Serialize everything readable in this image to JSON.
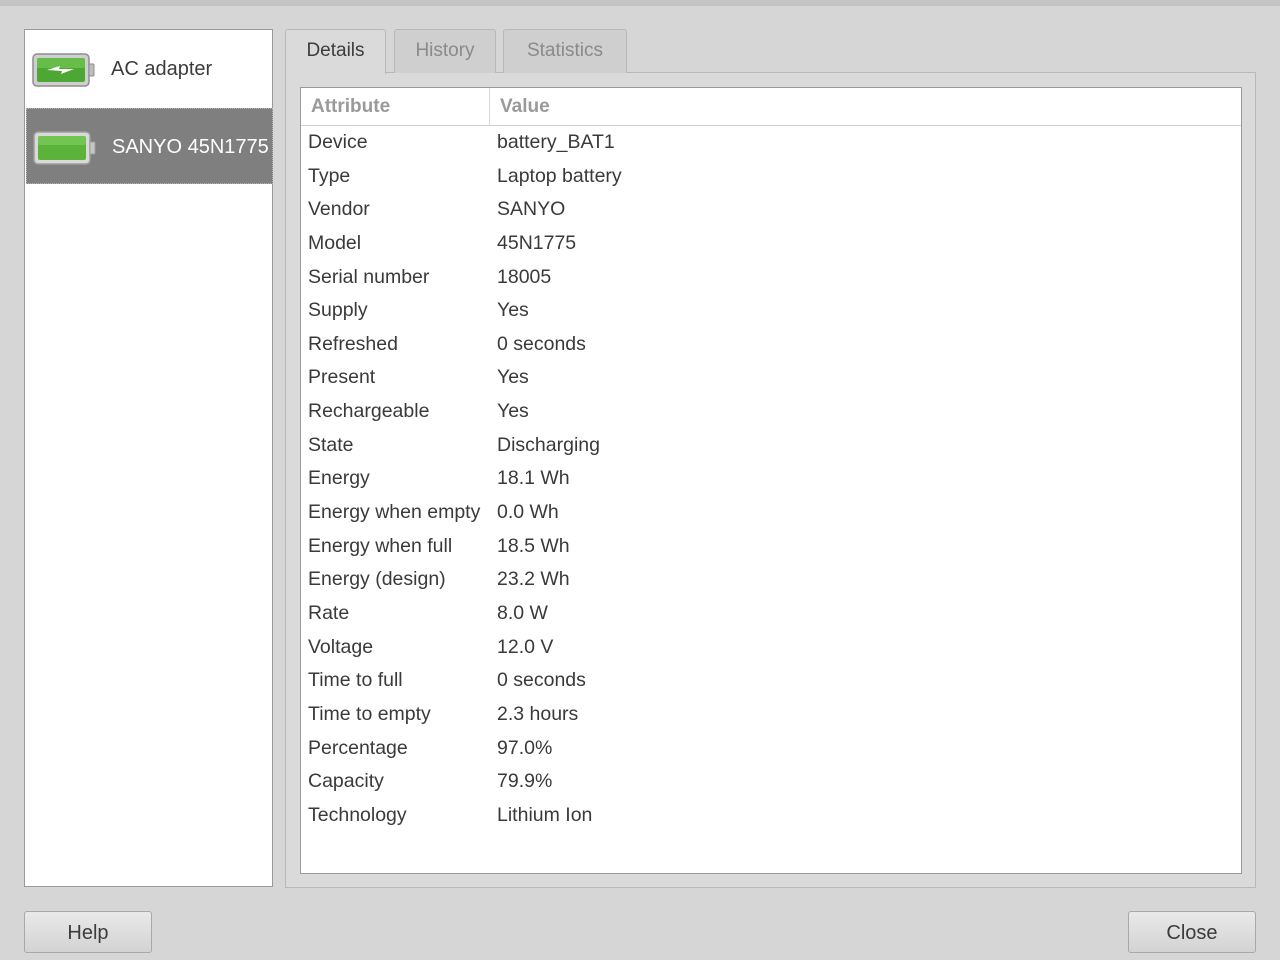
{
  "devices": [
    {
      "label": "AC adapter",
      "icon": "ac-adapter-icon"
    },
    {
      "label": "SANYO 45N1775",
      "icon": "battery-icon",
      "selected": true
    }
  ],
  "tabs": [
    {
      "label": "Details",
      "active": true
    },
    {
      "label": "History",
      "active": false
    },
    {
      "label": "Statistics",
      "active": false
    }
  ],
  "table": {
    "headers": {
      "attribute": "Attribute",
      "value": "Value"
    },
    "rows": [
      {
        "attr": "Device",
        "value": "battery_BAT1"
      },
      {
        "attr": "Type",
        "value": "Laptop battery"
      },
      {
        "attr": "Vendor",
        "value": "SANYO"
      },
      {
        "attr": "Model",
        "value": "45N1775"
      },
      {
        "attr": "Serial number",
        "value": "18005"
      },
      {
        "attr": "Supply",
        "value": "Yes"
      },
      {
        "attr": "Refreshed",
        "value": "0 seconds"
      },
      {
        "attr": "Present",
        "value": "Yes"
      },
      {
        "attr": "Rechargeable",
        "value": "Yes"
      },
      {
        "attr": "State",
        "value": "Discharging"
      },
      {
        "attr": "Energy",
        "value": "18.1 Wh"
      },
      {
        "attr": "Energy when empty",
        "value": "0.0 Wh"
      },
      {
        "attr": "Energy when full",
        "value": "18.5 Wh"
      },
      {
        "attr": "Energy (design)",
        "value": "23.2 Wh"
      },
      {
        "attr": "Rate",
        "value": "8.0 W"
      },
      {
        "attr": "Voltage",
        "value": "12.0 V"
      },
      {
        "attr": "Time to full",
        "value": "0 seconds"
      },
      {
        "attr": "Time to empty",
        "value": "2.3 hours"
      },
      {
        "attr": "Percentage",
        "value": "97.0%"
      },
      {
        "attr": "Capacity",
        "value": "79.9%"
      },
      {
        "attr": "Technology",
        "value": "Lithium Ion"
      }
    ]
  },
  "buttons": {
    "help": "Help",
    "close": "Close"
  },
  "colors": {
    "battery_green": "#5cb33a",
    "selection": "#7f7f7f"
  }
}
